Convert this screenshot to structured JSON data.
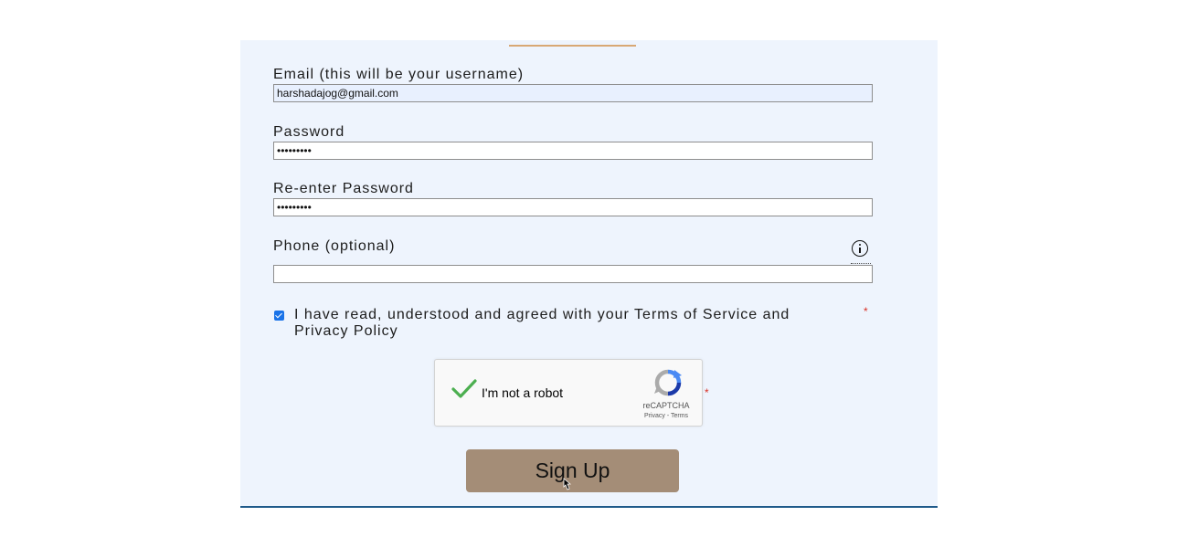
{
  "form": {
    "email": {
      "label": "Email (this will be your username)",
      "value": "harshadajog@gmail.com"
    },
    "password": {
      "label": "Password",
      "value": "•••••••••"
    },
    "reenter_password": {
      "label": "Re-enter Password",
      "value": "•••••••••"
    },
    "phone": {
      "label": "Phone (optional)",
      "value": ""
    },
    "terms": {
      "checked": true,
      "text": "I have read, understood and agreed with your Terms of Service and Privacy Policy",
      "required_marker": "*"
    },
    "recaptcha": {
      "label": "I'm not a robot",
      "brand": "reCAPTCHA",
      "links": "Privacy - Terms",
      "verified": true,
      "required_marker": "*"
    },
    "submit_label": "Sign Up"
  },
  "icons": {
    "phone_info": "info-icon",
    "recaptcha_check": "checkmark-icon",
    "recaptcha_logo": "recaptcha-logo-icon",
    "cursor": "hand-pointer-cursor-icon"
  },
  "colors": {
    "panel_background": "#eef4fd",
    "panel_border": "#1f5a8a",
    "top_accent": "#d8a874",
    "button": "#a48d77",
    "checkbox": "#1a73e8",
    "required": "#d93025",
    "recaptcha_check": "#4caf50"
  }
}
